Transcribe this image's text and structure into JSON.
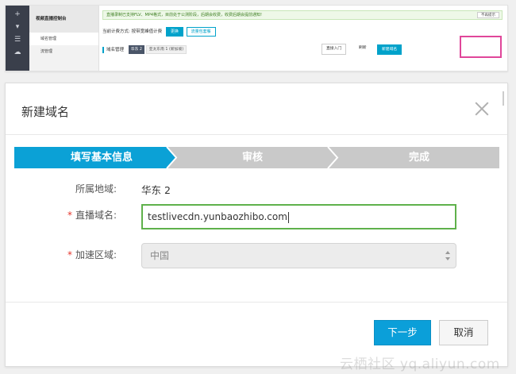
{
  "console": {
    "app_title": "视频直播控制台",
    "menu": [
      "域名管理",
      "流管理"
    ],
    "notice": "直播录制已支持FLV、MP4格式，目前处于公测阶段，后期会收费，收费后期会提前通知!",
    "notice_dismiss": "不再提示",
    "billing_label": "当前计费方式: 按带宽峰值计费",
    "billing_change": "更换",
    "billing_package": "流量包套餐",
    "domain_mgmt_label": "域名管理",
    "regions": [
      "华东 2",
      "亚太东南 1 (新加坡)"
    ],
    "buttons": {
      "guide": "直接入门",
      "refresh": "刷新",
      "new_domain": "新建域名"
    },
    "highlight_color": "#e0469a"
  },
  "dialog": {
    "title": "新建域名",
    "steps": [
      "填写基本信息",
      "审核",
      "完成"
    ],
    "active_step_color": "#0ba1d6",
    "inactive_step_color": "#c9c9c9",
    "fields": {
      "region_label": "所属地域:",
      "region_value": "华东 2",
      "domain_label": "直播域名:",
      "domain_value": "testlivecdn.yunbaozhibo.com",
      "area_label": "加速区域:",
      "area_value": "中国"
    },
    "buttons": {
      "next": "下一步",
      "cancel": "取消"
    }
  },
  "watermark": "云栖社区 yq.aliyun.com"
}
